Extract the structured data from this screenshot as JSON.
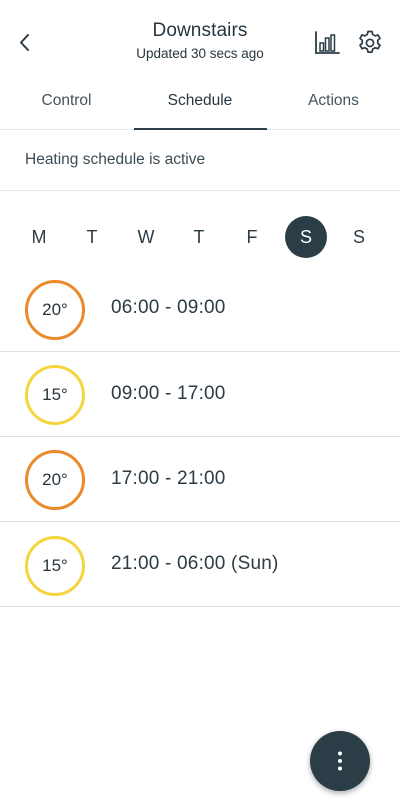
{
  "header": {
    "title": "Downstairs",
    "subtitle": "Updated 30 secs ago",
    "back_icon": "chevron-left-icon",
    "chart_icon": "bar-chart-icon",
    "settings_icon": "gear-icon"
  },
  "tabs": [
    {
      "label": "Control",
      "active": false
    },
    {
      "label": "Schedule",
      "active": true
    },
    {
      "label": "Actions",
      "active": false
    }
  ],
  "status": {
    "text": "Heating schedule is active"
  },
  "days": [
    {
      "label": "M",
      "selected": false
    },
    {
      "label": "T",
      "selected": false
    },
    {
      "label": "W",
      "selected": false
    },
    {
      "label": "T",
      "selected": false
    },
    {
      "label": "F",
      "selected": false
    },
    {
      "label": "S",
      "selected": true
    },
    {
      "label": "S",
      "selected": false
    }
  ],
  "schedule": [
    {
      "temp": "20°",
      "range": "06:00 - 09:00",
      "level": "high"
    },
    {
      "temp": "15°",
      "range": "09:00 - 17:00",
      "level": "low"
    },
    {
      "temp": "20°",
      "range": "17:00 - 21:00",
      "level": "high"
    },
    {
      "temp": "15°",
      "range": "21:00 - 06:00 (Sun)",
      "level": "low"
    }
  ],
  "colors": {
    "accent_dark": "#2b3d47",
    "temp_high": "#ea8a2a",
    "temp_low": "#f5d53d"
  },
  "fab": {
    "icon": "more-vertical-icon"
  }
}
